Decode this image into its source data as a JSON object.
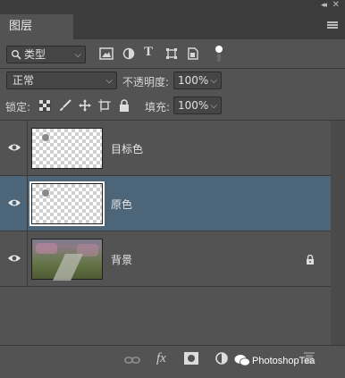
{
  "panel": {
    "tab_label": "图层"
  },
  "filter": {
    "kind_label": "类型"
  },
  "blend": {
    "mode": "正常",
    "opacity_label": "不透明度:",
    "opacity_value": "100%"
  },
  "lock": {
    "label": "锁定:",
    "fill_label": "填充:",
    "fill_value": "100%"
  },
  "layers": [
    {
      "name": "目标色",
      "visible": true,
      "selected": false,
      "type": "transparent"
    },
    {
      "name": "原色",
      "visible": true,
      "selected": true,
      "type": "transparent"
    },
    {
      "name": "背景",
      "visible": true,
      "selected": false,
      "type": "photo",
      "locked": true
    }
  ],
  "footer": {
    "fx_label": "fx",
    "watermark": "PhotoshopTea"
  },
  "colors": {
    "panel_bg": "#535353",
    "selected_layer": "#4d6579",
    "dark_bar": "#3c3c3c"
  }
}
